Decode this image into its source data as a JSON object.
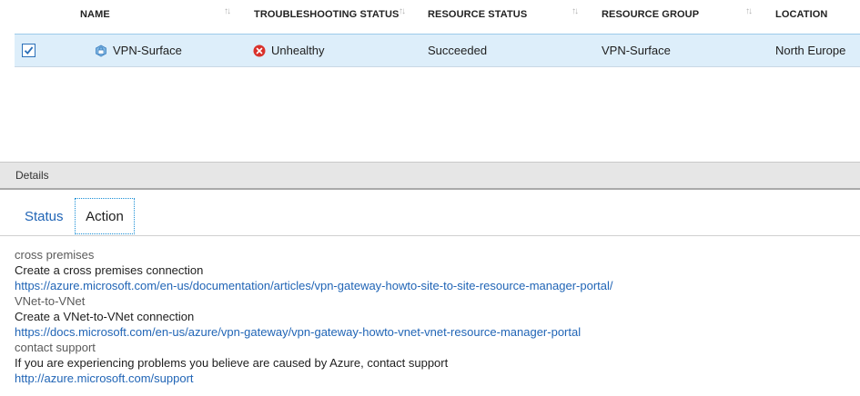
{
  "table": {
    "columns": [
      {
        "label": "NAME"
      },
      {
        "label": "TROUBLESHOOTING STATUS"
      },
      {
        "label": "RESOURCE STATUS"
      },
      {
        "label": "RESOURCE GROUP"
      },
      {
        "label": "LOCATION"
      }
    ],
    "sort_glyph": "↑↓",
    "rows": [
      {
        "selected": true,
        "name": "VPN-Surface",
        "troubleshooting_status": "Unhealthy",
        "resource_status": "Succeeded",
        "resource_group": "VPN-Surface",
        "location": "North Europe"
      }
    ]
  },
  "details": {
    "title": "Details",
    "tabs": [
      {
        "label": "Status",
        "active": false
      },
      {
        "label": "Action",
        "active": true
      }
    ]
  },
  "actions": [
    {
      "heading": "cross premises",
      "description": "Create a cross premises connection",
      "link": "https://azure.microsoft.com/en-us/documentation/articles/vpn-gateway-howto-site-to-site-resource-manager-portal/"
    },
    {
      "heading": "VNet-to-VNet",
      "description": "Create a VNet-to-VNet connection",
      "link": "https://docs.microsoft.com/en-us/azure/vpn-gateway/vpn-gateway-howto-vnet-vnet-resource-manager-portal"
    },
    {
      "heading": "contact support",
      "description": "If you are experiencing problems you believe are caused by Azure, contact support",
      "link": "http://azure.microsoft.com/support"
    }
  ],
  "colors": {
    "accent": "#2165b6",
    "row_selected": "#ddeefa",
    "error": "#d9312b"
  }
}
